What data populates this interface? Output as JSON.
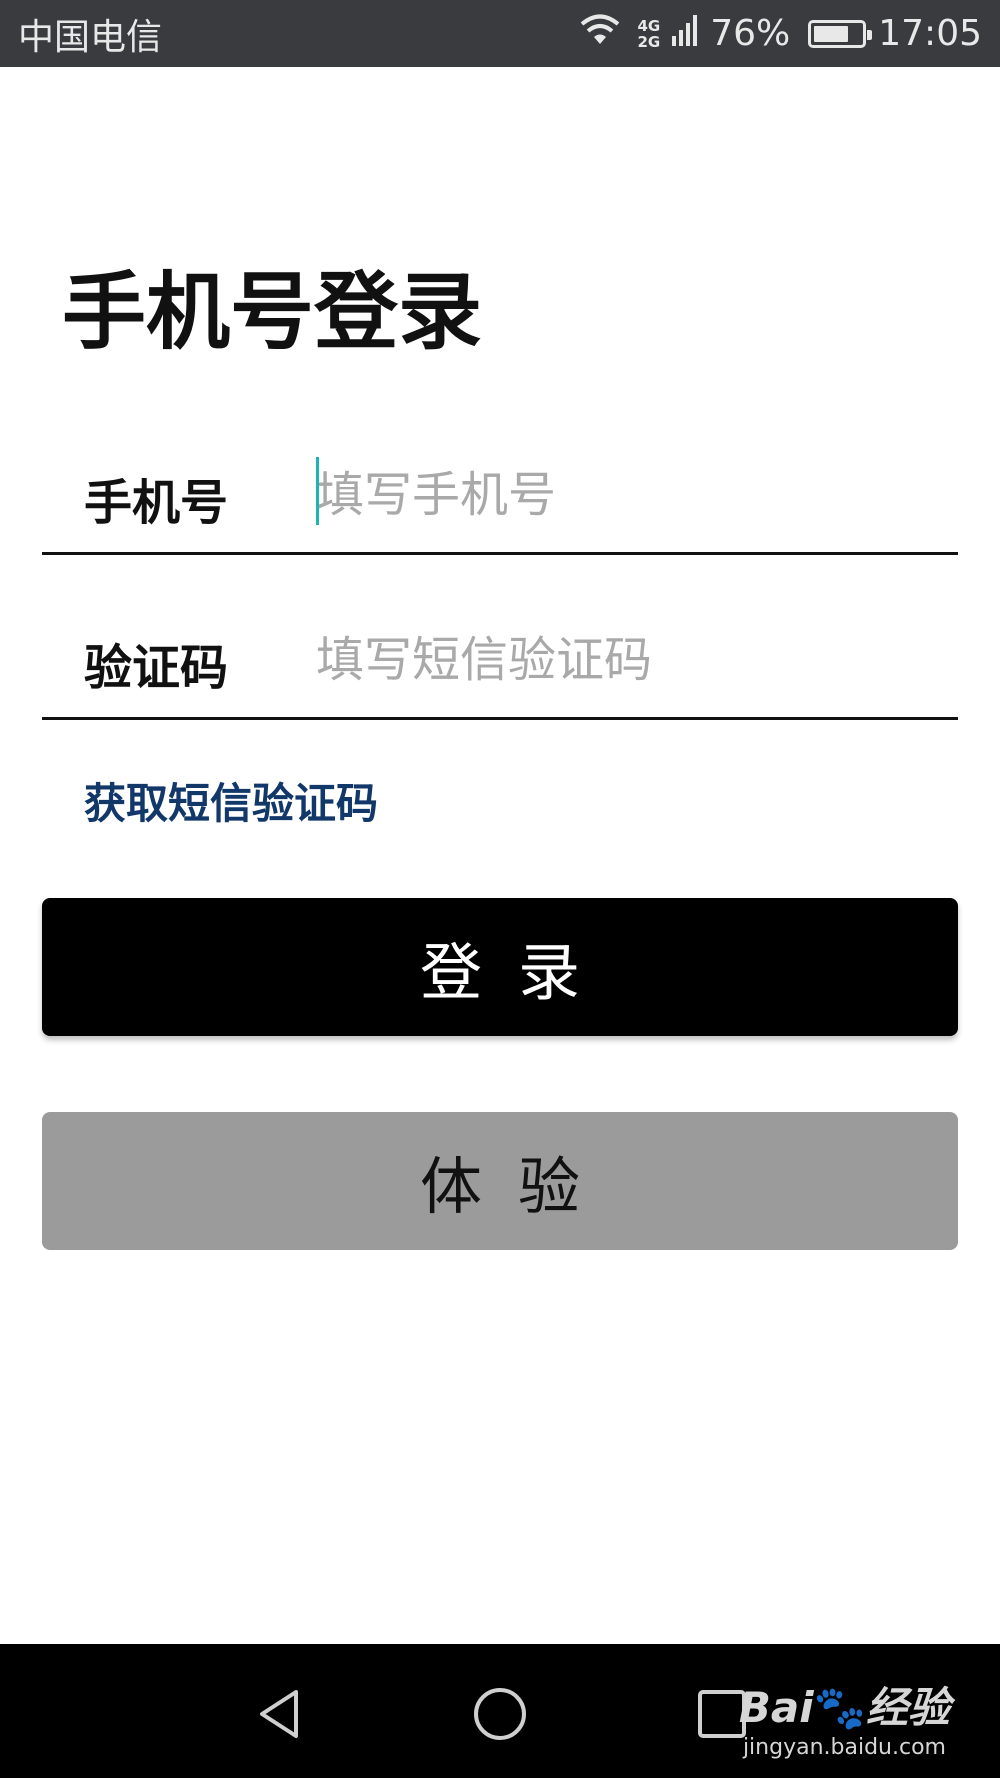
{
  "status_bar": {
    "carrier": "中国电信",
    "network_top": "4G",
    "network_bottom": "2G",
    "battery": "76%",
    "battery_level": 0.76,
    "time": "17:05",
    "icons": [
      "wifi-icon",
      "signal-icon",
      "battery-icon"
    ]
  },
  "page": {
    "title": "手机号登录"
  },
  "form": {
    "phone": {
      "label": "手机号",
      "placeholder": "填写手机号",
      "value": ""
    },
    "code": {
      "label": "验证码",
      "placeholder": "填写短信验证码",
      "value": ""
    },
    "get_code_label": "获取短信验证码"
  },
  "buttons": {
    "login": "登录",
    "trial": "体验"
  },
  "nav_bar": {
    "icons": [
      "back-triangle-icon",
      "home-circle-icon",
      "recent-square-icon"
    ]
  },
  "watermark": {
    "logo": "Bai",
    "logo_suffix": "经验",
    "url": "jingyan.baidu.com"
  },
  "colors": {
    "status_bar_bg": "#3a3b3f",
    "link": "#12386a",
    "login_bg": "#000000",
    "trial_bg": "#9b9b9b",
    "caret": "#1fb3b3"
  }
}
